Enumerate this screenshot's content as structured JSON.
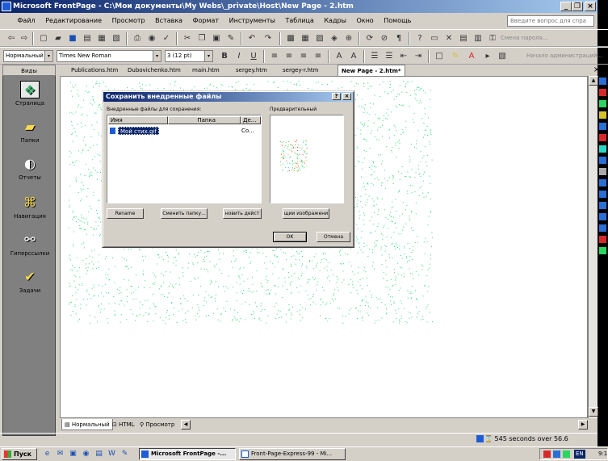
{
  "window": {
    "title": "Microsoft FrontPage - C:\\Мои документы\\My Webs\\_private\\Host\\New Page - 2.htm",
    "minimize": "_",
    "restore": "❐",
    "close": "×"
  },
  "menu": {
    "items": [
      "Файл",
      "Редактирование",
      "Просмотр",
      "Вставка",
      "Формат",
      "Инструменты",
      "Таблица",
      "Кадры",
      "Окно",
      "Помощь"
    ],
    "help_placeholder": "Введите вопрос для спра"
  },
  "format_toolbar": {
    "style": "Нормальный",
    "font": "Times New Roman",
    "size": "3 (12 pt)",
    "bold": "B",
    "italic": "I",
    "underline": "U",
    "right_hint": "Начало администраций..."
  },
  "std_toolbar": {
    "right_hint": "Смена пароля..."
  },
  "views": {
    "header": "Виды",
    "items": [
      "Страница",
      "Папки",
      "Отчеты",
      "Навигация",
      "Гиперссылки",
      "Задачи"
    ]
  },
  "tabs": [
    "Publications.htm",
    "Dubovichenko.htm",
    "main.htm",
    "sergey.htm",
    "sergey-r.htm",
    "New Page - 2.htm*"
  ],
  "tabs_close": "×",
  "view_tabs": [
    "Нормальный",
    "HTML",
    "Просмотр"
  ],
  "status": {
    "text": "545 seconds over 56.6"
  },
  "dialog": {
    "title": "Сохранить внедренные файлы",
    "help": "?",
    "close": "×",
    "files_label": "Внедренные файлы для сохранения:",
    "columns": [
      "Имя",
      "Папка",
      "Де..."
    ],
    "file_name": "Мой стих.gif",
    "file_action": "Со...",
    "preview_label": "Предварительный",
    "buttons": {
      "rename": "Rename",
      "change_folder": "Сменить папку...",
      "set_action": "новить дейст",
      "image_options": "щии изображени",
      "ok": "OK",
      "cancel": "Отмена"
    }
  },
  "taskbar": {
    "start": "Пуск",
    "tasks": [
      "Microsoft FrontPage -...",
      "Front-Page-Express-99 - Mi..."
    ],
    "lang": "EN",
    "clock": "9:1"
  }
}
